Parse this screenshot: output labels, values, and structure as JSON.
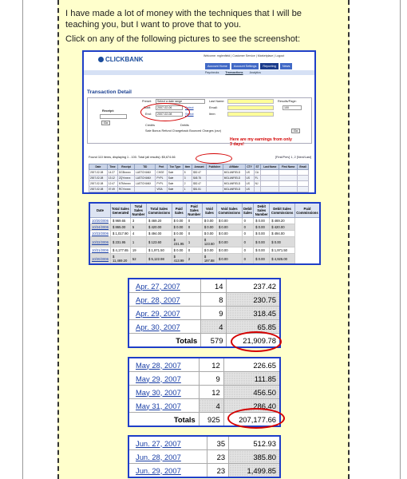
{
  "intro": {
    "text1": "I have made a lot of money with the techniques that I will be teaching you, but I want to prove that to you.",
    "text2": "Click on any of the following pictures to see the screenshot:"
  },
  "clickbank": {
    "logo": "CLICKBANK",
    "welcome": "Welcome: mglenfield | Customer Service | Marketplace | Logout",
    "nav": [
      "Account Home",
      "Account Settings",
      "Reporting",
      "News"
    ],
    "subnav": [
      "Paychecks",
      "Transactions",
      "Analytics"
    ],
    "title": "Transaction Detail",
    "labels": {
      "preset": "Preset:",
      "preset_value": "Select a date range",
      "start": "Start:",
      "start_value": "2007-02-06",
      "select": "Select",
      "end": "End:",
      "end_value": "2007-02-08",
      "receipt": "Receipt:",
      "go": "Go",
      "last_name": "Last Name:",
      "email": "Email:",
      "item": "Item:",
      "results_page": "Results/Page:",
      "results_value": "100",
      "credits": "Credits",
      "debits": "Debits",
      "checkboxes": "Sale  Bonus  Refund  Chargeback  Bounced  Charges  (csv)",
      "found": "Found 110 items, displaying 1 - 100.    Total (all results): $5,674.66",
      "paging": "[First/Prev] 1, 2 [Next/Last]"
    },
    "annotation": "Here are my earnings from only 3 days!",
    "table_headers": [
      "Date",
      "Time",
      "Receipt",
      "TID",
      "Pmt",
      "Txn Type",
      "Item",
      "Amount",
      "Publisher",
      "Affiliate",
      "CTY",
      "ST",
      "Last Name",
      "First Name",
      "Email"
    ],
    "table_rows": [
      [
        "2007-02-08",
        "14:27",
        "DGBxxxxx",
        "LASTCHANX",
        "CHGE",
        "Sale",
        "5",
        "$52.47",
        "",
        "MGLANFIELD",
        "US",
        "CA",
        "",
        "",
        ""
      ],
      [
        "2007-02-08",
        "13:12",
        "ZQYxxxxx",
        "LASTCHANX",
        "PYPL",
        "Sale",
        "3",
        "$45.75",
        "",
        "MGLANFIELD",
        "US",
        "FL",
        "",
        "",
        ""
      ],
      [
        "2007-02-08",
        "12:47",
        "NTMxxxxx",
        "LASTCHANX",
        "PYPL",
        "Sale",
        "2",
        "$52.47",
        "",
        "MGLANFIELD",
        "US",
        "NJ",
        "",
        "",
        ""
      ],
      [
        "2007-02-08",
        "07:49",
        "RCYxxxxx",
        "",
        "VISA",
        "Sale",
        "1",
        "$51.51",
        "",
        "MGLANFIELD",
        "US",
        "",
        "",
        "",
        ""
      ]
    ]
  },
  "summary": {
    "headers": [
      "Date",
      "Total Sales Generated",
      "Total Sales Number",
      "Total Sales Commissions",
      "Paid Sales",
      "Paid Sales Number",
      "Void Sales",
      "Void Sales Commissions",
      "Debit Sales",
      "Debit Sales Number",
      "Debit Sales Commissions",
      "Paid Commissions"
    ],
    "rows": [
      [
        "10/20/2006",
        "$ 969.65",
        "3",
        "$ 469.20",
        "$ 0.00",
        "0",
        "$ 0.00",
        "$ 0.00",
        "0",
        "$ 0.00",
        "$ 469.20"
      ],
      [
        "10/24/2006",
        "$ 865.00",
        "5",
        "$ 420.00",
        "$ 0.00",
        "0",
        "$ 0.00",
        "$ 0.00",
        "0",
        "$ 0.00",
        "$ 420.00"
      ],
      [
        "10/23/2006",
        "$ 1,017.90",
        "4",
        "$ 494.00",
        "$ 0.00",
        "0",
        "$ 0.00",
        "$ 0.00",
        "0",
        "$ 0.00",
        "$ 494.00"
      ],
      [
        "10/22/2006",
        "$ 231.95",
        "1",
        "$ 123.60",
        "$ 231.95",
        "1",
        "$ 123.60",
        "$ 0.00",
        "0",
        "$ 0.00",
        "$ 0.00"
      ],
      [
        "10/21/2006",
        "$ 4,177.65",
        "19",
        "$ 1,971.50",
        "$ 0.00",
        "0",
        "$ 0.00",
        "$ 0.00",
        "0",
        "$ 0.00",
        "$ 1,971.50"
      ],
      [
        "10/20/2006",
        "$ 11,469.20",
        "52",
        "$ 5,122.98",
        "$ 413.99",
        "2",
        "$ 197.88",
        "$ 0.00",
        "0",
        "$ 0.00",
        "$ 4,925.00"
      ]
    ]
  },
  "april": {
    "rows": [
      [
        "Apr. 27, 2007",
        "14",
        "237.42"
      ],
      [
        "Apr. 28, 2007",
        "8",
        "230.75"
      ],
      [
        "Apr. 29, 2007",
        "9",
        "318.45"
      ],
      [
        "Apr. 30, 2007",
        "4",
        "65.85"
      ]
    ],
    "total_label": "Totals",
    "total_count": "579",
    "total_amount": "21,909.78"
  },
  "may": {
    "rows": [
      [
        "May 28, 2007",
        "12",
        "226.65"
      ],
      [
        "May 29, 2007",
        "9",
        "111.85"
      ],
      [
        "May 30, 2007",
        "12",
        "456.50"
      ],
      [
        "May 31, 2007",
        "4",
        "286.40"
      ]
    ],
    "total_label": "Totals",
    "total_count": "925",
    "total_amount": "207,177.66"
  },
  "june": {
    "rows": [
      [
        "Jun. 27, 2007",
        "35",
        "512.93"
      ],
      [
        "Jun. 28, 2007",
        "23",
        "385.80"
      ],
      [
        "Jun. 29, 2007",
        "23",
        "1,499.85"
      ]
    ]
  }
}
